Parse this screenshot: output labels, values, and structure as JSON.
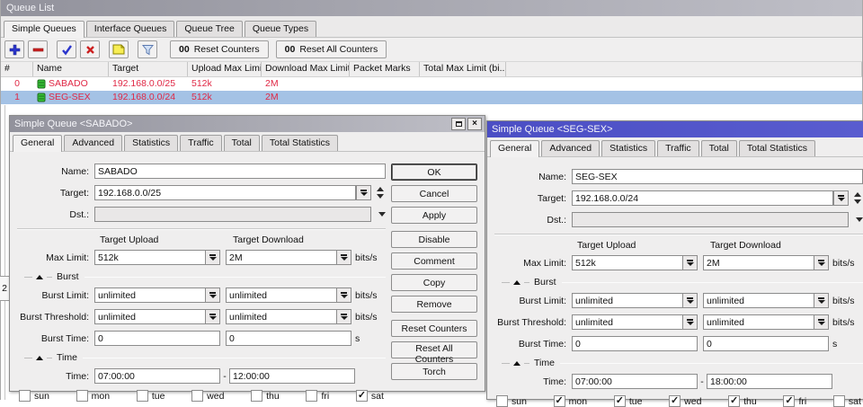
{
  "colors": {
    "selection-bg": "#a4c2e5",
    "row-red": "#e02845",
    "title-active-1": "#4b4ec4",
    "title-active-2": "#5d60d2",
    "title-inactive-1": "#92929c",
    "title-inactive-2": "#bfbfc7"
  },
  "queue_list": {
    "title": "Queue List",
    "tabs": [
      {
        "label": "Simple Queues",
        "active": true
      },
      {
        "label": "Interface Queues",
        "active": false
      },
      {
        "label": "Queue Tree",
        "active": false
      },
      {
        "label": "Queue Types",
        "active": false
      }
    ],
    "toolbar": {
      "icons": [
        "add",
        "remove",
        "enable",
        "disable",
        "comment",
        "filter"
      ],
      "counter_prefix": "00",
      "reset_counters_label": "Reset Counters",
      "reset_all_counters_label": "Reset All Counters"
    },
    "table": {
      "columns": [
        "#",
        "Name",
        "Target",
        "Upload Max Limit",
        "Download Max Limit",
        "Packet Marks",
        "Total Max Limit (bi...",
        ""
      ],
      "rows": [
        {
          "num": "0",
          "icon": "queue-icon",
          "name": "SABADO",
          "target": "192.168.0.0/25",
          "upload_max_limit": "512k",
          "download_max_limit": "2M",
          "packet_marks": "",
          "total_max_limit": "",
          "selected": false
        },
        {
          "num": "1",
          "icon": "queue-icon",
          "name": "SEG-SEX",
          "target": "192.168.0.0/24",
          "upload_max_limit": "512k",
          "download_max_limit": "2M",
          "packet_marks": "",
          "total_max_limit": "",
          "selected": true
        }
      ]
    },
    "item_count": "2"
  },
  "dialog_labels": {
    "name_label": "Name:",
    "target_label": "Target:",
    "dst_label": "Dst.:",
    "target_upload": "Target Upload",
    "target_download": "Target Download",
    "max_limit_label": "Max Limit:",
    "burst_section": "Burst",
    "burst_limit_label": "Burst Limit:",
    "burst_threshold_label": "Burst Threshold:",
    "burst_time_label": "Burst Time:",
    "time_section": "Time",
    "time_label": "Time:",
    "bits_unit": "bits/s",
    "seconds_unit": "s",
    "dash": "-"
  },
  "dialogs": {
    "sabado": {
      "title": "Simple Queue <SABADO>",
      "tabs": [
        {
          "label": "General",
          "active": true
        },
        {
          "label": "Advanced",
          "active": false
        },
        {
          "label": "Statistics",
          "active": false
        },
        {
          "label": "Traffic",
          "active": false
        },
        {
          "label": "Total",
          "active": false
        },
        {
          "label": "Total Statistics",
          "active": false
        }
      ],
      "name": "SABADO",
      "target": "192.168.0.0/25",
      "dst": "",
      "max_limit_upload": "512k",
      "max_limit_download": "2M",
      "burst_limit_upload": "unlimited",
      "burst_limit_download": "unlimited",
      "burst_threshold_upload": "unlimited",
      "burst_threshold_download": "unlimited",
      "burst_time_upload": "0",
      "burst_time_download": "0",
      "time_from": "07:00:00",
      "time_to": "12:00:00",
      "days": [
        {
          "label": "sun",
          "checked": false
        },
        {
          "label": "mon",
          "checked": false
        },
        {
          "label": "tue",
          "checked": false
        },
        {
          "label": "wed",
          "checked": false
        },
        {
          "label": "thu",
          "checked": false
        },
        {
          "label": "fri",
          "checked": false
        },
        {
          "label": "sat",
          "checked": true
        }
      ],
      "button_groups": [
        [
          "OK",
          "Cancel",
          "Apply"
        ],
        [
          "Disable",
          "Comment",
          "Copy",
          "Remove"
        ],
        [
          "Reset Counters",
          "Reset All Counters",
          "Torch"
        ]
      ]
    },
    "segsex": {
      "title": "Simple Queue <SEG-SEX>",
      "tabs": [
        {
          "label": "General",
          "active": true
        },
        {
          "label": "Advanced",
          "active": false
        },
        {
          "label": "Statistics",
          "active": false
        },
        {
          "label": "Traffic",
          "active": false
        },
        {
          "label": "Total",
          "active": false
        },
        {
          "label": "Total Statistics",
          "active": false
        }
      ],
      "name": "SEG-SEX",
      "target": "192.168.0.0/24",
      "dst": "",
      "max_limit_upload": "512k",
      "max_limit_download": "2M",
      "burst_limit_upload": "unlimited",
      "burst_limit_download": "unlimited",
      "burst_threshold_upload": "unlimited",
      "burst_threshold_download": "unlimited",
      "burst_time_upload": "0",
      "burst_time_download": "0",
      "time_from": "07:00:00",
      "time_to": "18:00:00",
      "days": [
        {
          "label": "sun",
          "checked": false
        },
        {
          "label": "mon",
          "checked": true
        },
        {
          "label": "tue",
          "checked": true
        },
        {
          "label": "wed",
          "checked": true
        },
        {
          "label": "thu",
          "checked": true
        },
        {
          "label": "fri",
          "checked": true
        },
        {
          "label": "sat",
          "checked": false
        }
      ]
    }
  }
}
